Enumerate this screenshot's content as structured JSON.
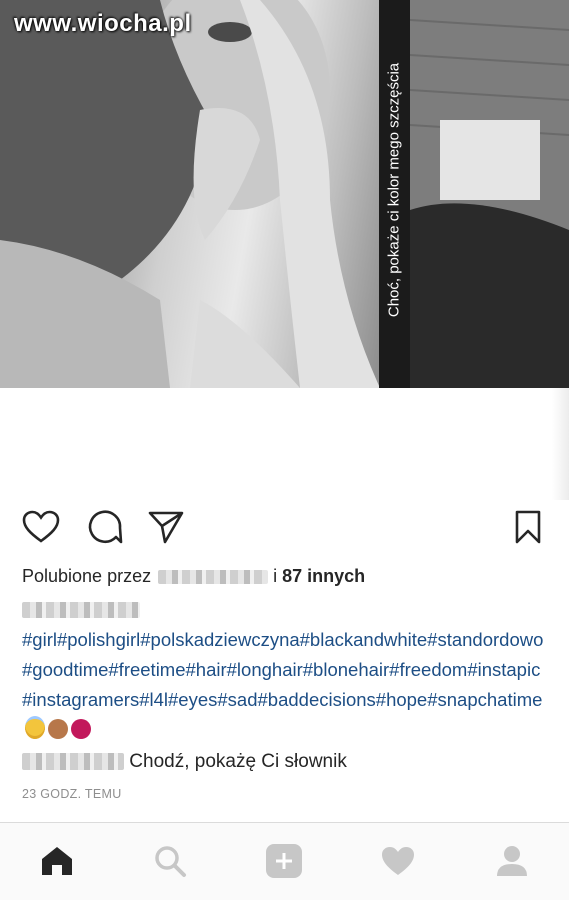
{
  "watermark": "www.wiocha.pl",
  "photo": {
    "caption": "Choć, pokaże ci kolor mego szczęścia"
  },
  "actions": {
    "like_icon": "heart-icon",
    "comment_icon": "comment-icon",
    "share_icon": "send-icon",
    "save_icon": "bookmark-icon"
  },
  "likes": {
    "prefix": "Polubione przez",
    "suffix_i": "i",
    "count_text": "87 innych"
  },
  "post": {
    "hashtags": "#girl#polishgirl#polskadziewczyna#blackandwhite#standordowo#goodtime#freetime#hair#longhair#blonehair#freedom#instapic#instagramers#l4l#eyes#sad#baddecisions#hope#snapchatime"
  },
  "comment": {
    "text": "Chodź, pokażę Ci słownik"
  },
  "timestamp": "23 GODZ. TEMU",
  "tabbar": {
    "items": [
      "home-icon",
      "search-icon",
      "add-icon",
      "heart-icon",
      "profile-icon"
    ]
  },
  "colors": {
    "hashtag": "#1d4e85",
    "timestamp": "#8e8e8e",
    "tabbar_bg": "#fafafa"
  }
}
